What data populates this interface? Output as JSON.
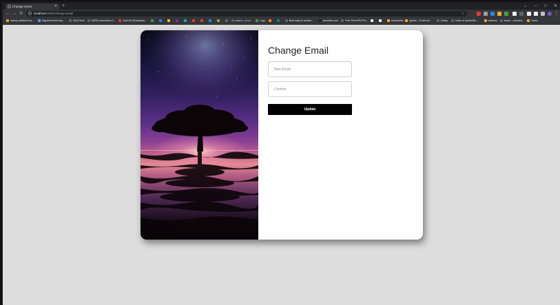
{
  "browser": {
    "tab_title": "Change email",
    "new_tab_symbol": "+",
    "url_host": "localhost",
    "url_path": ":3000/change-email",
    "window_controls": [
      "⌄",
      "–",
      "□",
      "✕"
    ],
    "bookmarks": [
      {
        "label": "hamep plattform ba...",
        "color": "#e8a33d"
      },
      {
        "label": "Alignment free seq...",
        "color": "#4fa3e0"
      },
      {
        "label": "NLM Virus",
        "color": "#5f6368"
      },
      {
        "label": "SARS coronavirus 2...",
        "color": "#5f6368"
      },
      {
        "label": "Suet Ark (Paraphylo...",
        "color": "#e53935"
      },
      {
        "label": "",
        "color": "#43a047"
      },
      {
        "label": "",
        "color": "#1e88e5"
      },
      {
        "label": "",
        "color": "#fbc02d"
      },
      {
        "label": "",
        "color": "#8e24aa"
      },
      {
        "label": "",
        "color": "#00acc1"
      },
      {
        "label": "",
        "color": "#e53935"
      },
      {
        "label": "",
        "color": "#e53935"
      },
      {
        "label": "",
        "color": "#1e88e5"
      },
      {
        "label": "",
        "color": "#7cb342"
      },
      {
        "label": "...ביניים - הרצאה 11",
        "color": "#5f6368"
      },
      {
        "label": "Lego",
        "color": "#43a047"
      },
      {
        "label": "",
        "color": "#fb8c00"
      },
      {
        "label": "",
        "color": "#00897b"
      },
      {
        "label": "Best ways to activat...",
        "color": "#5f6368"
      },
      {
        "label": "simulator.com",
        "color": "#212121"
      },
      {
        "label": "Free PureVPN Pro...",
        "color": "#5f6368"
      },
      {
        "label": "",
        "color": "#eeeeee"
      },
      {
        "label": "",
        "color": "#eeeeee"
      },
      {
        "label": "bookmarks",
        "color": "#f9a825"
      },
      {
        "label": "python - Could not...",
        "color": "#f9a825"
      },
      {
        "label": "Zulary",
        "color": "#5f6368"
      },
      {
        "label": "Index of /public/Bo...",
        "color": "#5f6368"
      },
      {
        "label": "watches",
        "color": "#f9a825"
      },
      {
        "label": "Aaron - moment...",
        "color": "#5f6368"
      },
      {
        "label": "Todos",
        "color": "#f9a825"
      }
    ]
  },
  "card": {
    "title": "Change Email",
    "new_email_placeholder": "New Email",
    "confirm_placeholder": "Confirm",
    "update_label": "Update"
  },
  "colors": {
    "page_background": "#dddddd",
    "button": "#000000",
    "card": "#ffffff"
  },
  "icons": {
    "back": "arrow-left-icon",
    "forward": "arrow-right-icon",
    "reload": "reload-icon",
    "bookmark": "star-icon"
  }
}
